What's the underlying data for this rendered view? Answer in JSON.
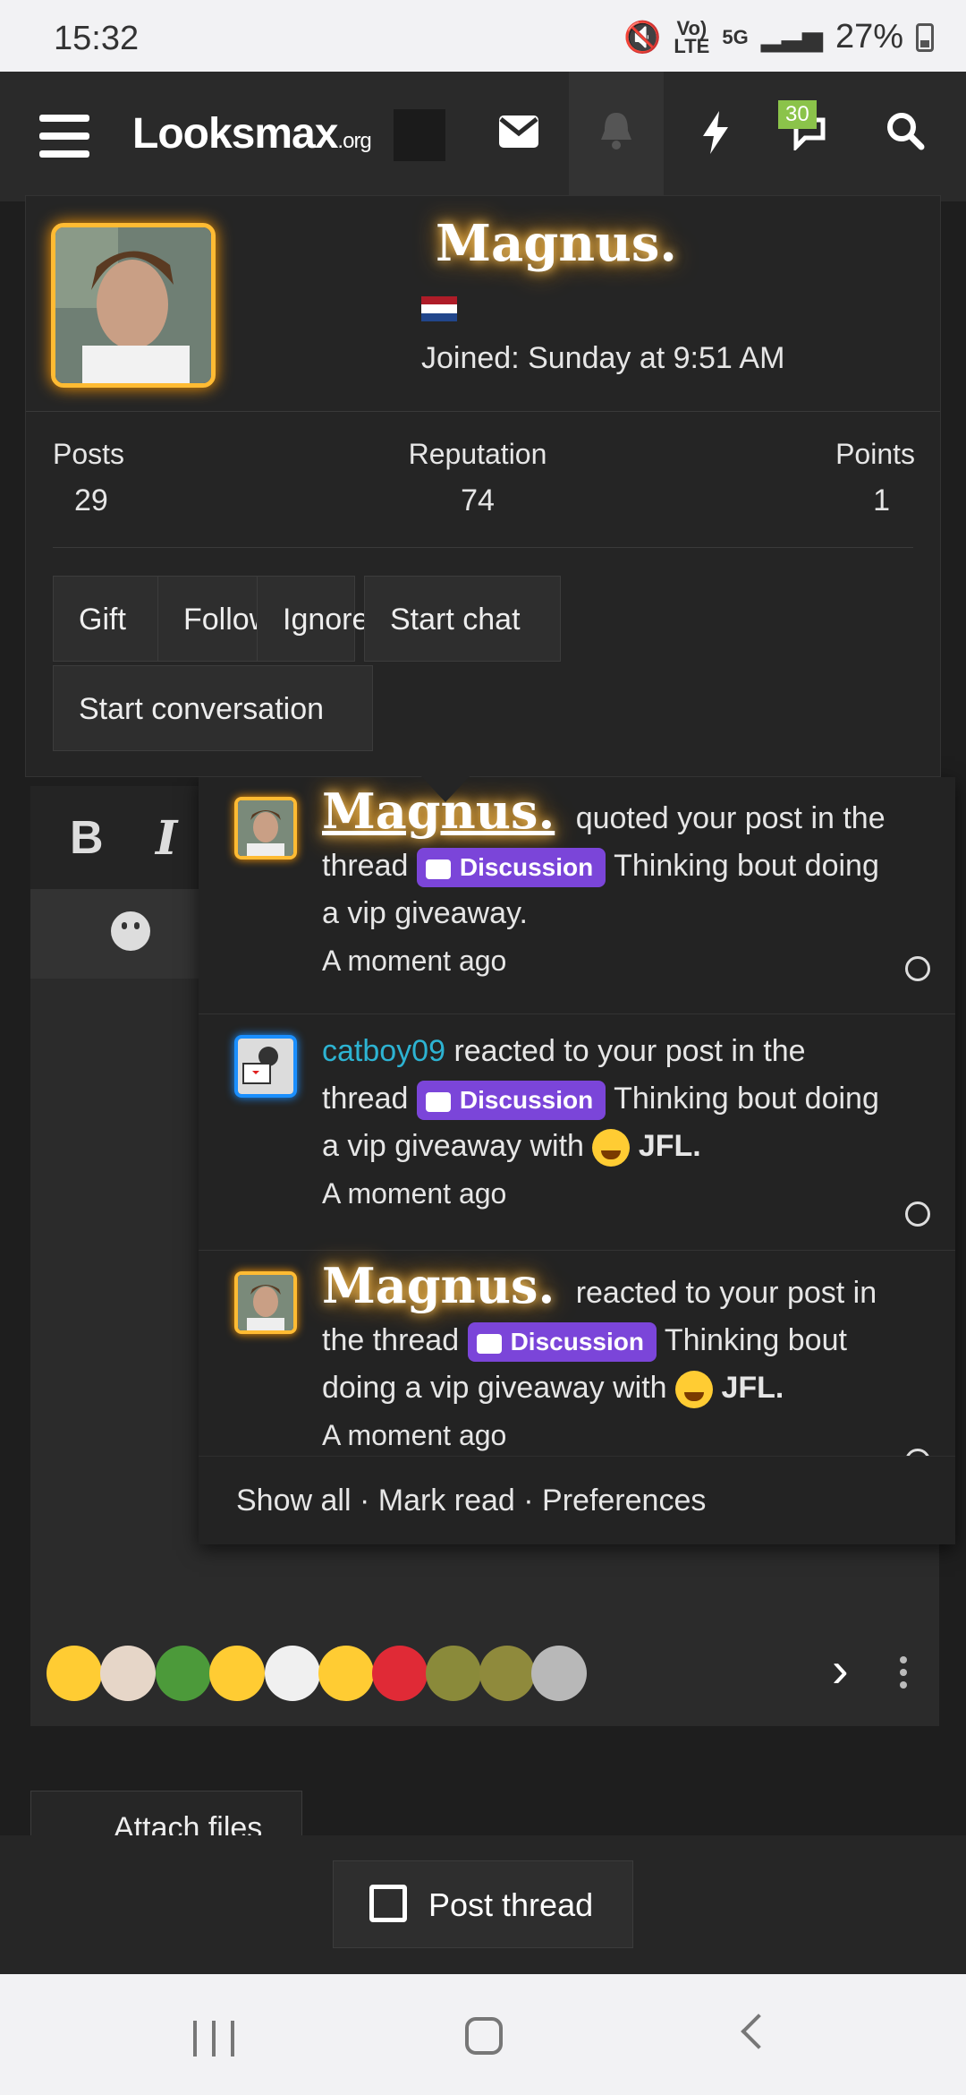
{
  "status_bar": {
    "time": "15:32",
    "network": "Vo) LTE",
    "signal": "5G",
    "battery": "27%"
  },
  "header": {
    "logo_main": "Looksmax",
    "logo_tld": ".org",
    "messages_badge": "30"
  },
  "profile": {
    "name": "Magnus.",
    "joined": "Joined: Sunday at 9:51 AM",
    "stats": [
      {
        "label": "Posts",
        "value": "29"
      },
      {
        "label": "Reputation",
        "value": "74"
      },
      {
        "label": "Points",
        "value": "1"
      }
    ],
    "buttons": {
      "gift": "Gift",
      "follow": "Follow",
      "ignore": "Ignore",
      "start_chat": "Start chat",
      "start_conversation": "Start conversation"
    }
  },
  "notifications": {
    "items": [
      {
        "user": "Magnus.",
        "action": "quoted your post in the thread",
        "prefix": "Discussion",
        "thread": "Thinking bout doing a vip giveaway.",
        "time": "A moment ago"
      },
      {
        "user": "catboy09",
        "action": "reacted to your post in the thread",
        "prefix": "Discussion",
        "thread": "Thinking bout doing a vip giveaway with",
        "reaction": "JFL.",
        "time": "A moment ago"
      },
      {
        "user": "Magnus.",
        "action": "reacted to your post in the thread",
        "prefix": "Discussion",
        "thread": "Thinking bout doing a vip giveaway with",
        "reaction": "JFL.",
        "time": "A moment ago"
      }
    ],
    "footer": {
      "show_all": "Show all",
      "mark_read": "Mark read",
      "preferences": "Preferences",
      "separator": "·"
    }
  },
  "editor": {
    "bold": "B",
    "italic": "I",
    "attach": "Attach files"
  },
  "post_thread": "Post thread"
}
